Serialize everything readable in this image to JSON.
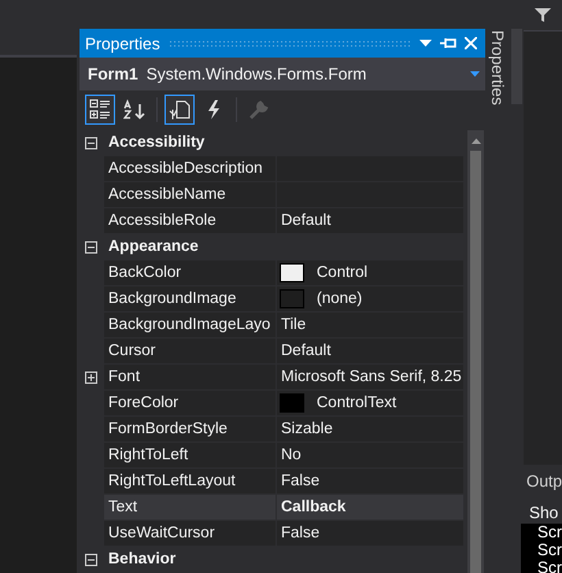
{
  "window": {
    "title": "Properties"
  },
  "object_selector": {
    "name": "Form1",
    "type": "System.Windows.Forms.Form"
  },
  "toolbar": [
    {
      "kind": "categorized",
      "selected": true,
      "disabled": false
    },
    {
      "kind": "alphabetical",
      "selected": false,
      "disabled": false
    },
    {
      "kind": "properties",
      "selected": true,
      "disabled": false
    },
    {
      "kind": "events",
      "selected": false,
      "disabled": false
    },
    {
      "kind": "property_pages",
      "selected": false,
      "disabled": true
    }
  ],
  "side_tab": {
    "label": "Properties"
  },
  "grid": [
    {
      "kind": "category",
      "label": "Accessibility",
      "expanded": true
    },
    {
      "kind": "property",
      "name": "AccessibleDescription",
      "selected": false
    },
    {
      "kind": "property",
      "name": "AccessibleName",
      "selected": false
    },
    {
      "kind": "property",
      "name": "AccessibleRole",
      "value": "Default",
      "modified": false,
      "selected": false
    },
    {
      "kind": "category",
      "label": "Appearance",
      "expanded": true
    },
    {
      "kind": "property",
      "name": "BackColor",
      "value": "Control",
      "color": "#f0f0f0",
      "modified": false,
      "selected": false
    },
    {
      "kind": "property",
      "name": "BackgroundImage",
      "value": "(none)",
      "color": "#1e1e1e",
      "modified": false,
      "selected": false
    },
    {
      "kind": "property",
      "name": "BackgroundImageLayo",
      "value": "Tile",
      "modified": false,
      "selected": false
    },
    {
      "kind": "property",
      "name": "Cursor",
      "value": "Default",
      "modified": false,
      "selected": false
    },
    {
      "kind": "property",
      "name": "Font",
      "value": "Microsoft Sans Serif, 8.25",
      "expandable": true,
      "expanded": false,
      "modified": false,
      "selected": false
    },
    {
      "kind": "property",
      "name": "ForeColor",
      "value": "ControlText",
      "color": "#000000",
      "modified": false,
      "selected": false
    },
    {
      "kind": "property",
      "name": "FormBorderStyle",
      "value": "Sizable",
      "modified": false,
      "selected": false
    },
    {
      "kind": "property",
      "name": "RightToLeft",
      "value": "No",
      "modified": false,
      "selected": false
    },
    {
      "kind": "property",
      "name": "RightToLeftLayout",
      "value": "False",
      "modified": false,
      "selected": false
    },
    {
      "kind": "property",
      "name": "Text",
      "value": "Callback",
      "modified": true,
      "selected": true
    },
    {
      "kind": "property",
      "name": "UseWaitCursor",
      "value": "False",
      "modified": false,
      "selected": false
    },
    {
      "kind": "category",
      "label": "Behavior",
      "expanded": true
    }
  ],
  "output": {
    "title": "Outp",
    "show_label": "Sho",
    "lines": [
      "Scr",
      "Scr",
      "Scr"
    ]
  }
}
